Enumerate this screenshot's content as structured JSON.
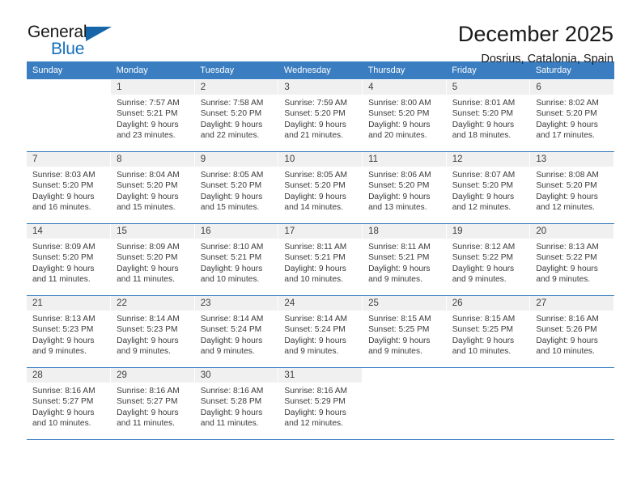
{
  "brand": {
    "name_part1": "General",
    "name_part2": "Blue",
    "triangle_color": "#1565a8",
    "blue_color": "#1570bd"
  },
  "header": {
    "title": "December 2025",
    "subtitle": "Dosrius, Catalonia, Spain"
  },
  "theme": {
    "header_blue": "#3a7dc0",
    "daynum_band": "#f0f0f0",
    "text": "#3a3a3a"
  },
  "columns": [
    "Sunday",
    "Monday",
    "Tuesday",
    "Wednesday",
    "Thursday",
    "Friday",
    "Saturday"
  ],
  "weeks": [
    [
      {
        "day": "",
        "sunrise": "",
        "sunset": "",
        "daylight_line1": "",
        "daylight_line2": ""
      },
      {
        "day": "1",
        "sunrise": "Sunrise: 7:57 AM",
        "sunset": "Sunset: 5:21 PM",
        "daylight_line1": "Daylight: 9 hours",
        "daylight_line2": "and 23 minutes."
      },
      {
        "day": "2",
        "sunrise": "Sunrise: 7:58 AM",
        "sunset": "Sunset: 5:20 PM",
        "daylight_line1": "Daylight: 9 hours",
        "daylight_line2": "and 22 minutes."
      },
      {
        "day": "3",
        "sunrise": "Sunrise: 7:59 AM",
        "sunset": "Sunset: 5:20 PM",
        "daylight_line1": "Daylight: 9 hours",
        "daylight_line2": "and 21 minutes."
      },
      {
        "day": "4",
        "sunrise": "Sunrise: 8:00 AM",
        "sunset": "Sunset: 5:20 PM",
        "daylight_line1": "Daylight: 9 hours",
        "daylight_line2": "and 20 minutes."
      },
      {
        "day": "5",
        "sunrise": "Sunrise: 8:01 AM",
        "sunset": "Sunset: 5:20 PM",
        "daylight_line1": "Daylight: 9 hours",
        "daylight_line2": "and 18 minutes."
      },
      {
        "day": "6",
        "sunrise": "Sunrise: 8:02 AM",
        "sunset": "Sunset: 5:20 PM",
        "daylight_line1": "Daylight: 9 hours",
        "daylight_line2": "and 17 minutes."
      }
    ],
    [
      {
        "day": "7",
        "sunrise": "Sunrise: 8:03 AM",
        "sunset": "Sunset: 5:20 PM",
        "daylight_line1": "Daylight: 9 hours",
        "daylight_line2": "and 16 minutes."
      },
      {
        "day": "8",
        "sunrise": "Sunrise: 8:04 AM",
        "sunset": "Sunset: 5:20 PM",
        "daylight_line1": "Daylight: 9 hours",
        "daylight_line2": "and 15 minutes."
      },
      {
        "day": "9",
        "sunrise": "Sunrise: 8:05 AM",
        "sunset": "Sunset: 5:20 PM",
        "daylight_line1": "Daylight: 9 hours",
        "daylight_line2": "and 15 minutes."
      },
      {
        "day": "10",
        "sunrise": "Sunrise: 8:05 AM",
        "sunset": "Sunset: 5:20 PM",
        "daylight_line1": "Daylight: 9 hours",
        "daylight_line2": "and 14 minutes."
      },
      {
        "day": "11",
        "sunrise": "Sunrise: 8:06 AM",
        "sunset": "Sunset: 5:20 PM",
        "daylight_line1": "Daylight: 9 hours",
        "daylight_line2": "and 13 minutes."
      },
      {
        "day": "12",
        "sunrise": "Sunrise: 8:07 AM",
        "sunset": "Sunset: 5:20 PM",
        "daylight_line1": "Daylight: 9 hours",
        "daylight_line2": "and 12 minutes."
      },
      {
        "day": "13",
        "sunrise": "Sunrise: 8:08 AM",
        "sunset": "Sunset: 5:20 PM",
        "daylight_line1": "Daylight: 9 hours",
        "daylight_line2": "and 12 minutes."
      }
    ],
    [
      {
        "day": "14",
        "sunrise": "Sunrise: 8:09 AM",
        "sunset": "Sunset: 5:20 PM",
        "daylight_line1": "Daylight: 9 hours",
        "daylight_line2": "and 11 minutes."
      },
      {
        "day": "15",
        "sunrise": "Sunrise: 8:09 AM",
        "sunset": "Sunset: 5:20 PM",
        "daylight_line1": "Daylight: 9 hours",
        "daylight_line2": "and 11 minutes."
      },
      {
        "day": "16",
        "sunrise": "Sunrise: 8:10 AM",
        "sunset": "Sunset: 5:21 PM",
        "daylight_line1": "Daylight: 9 hours",
        "daylight_line2": "and 10 minutes."
      },
      {
        "day": "17",
        "sunrise": "Sunrise: 8:11 AM",
        "sunset": "Sunset: 5:21 PM",
        "daylight_line1": "Daylight: 9 hours",
        "daylight_line2": "and 10 minutes."
      },
      {
        "day": "18",
        "sunrise": "Sunrise: 8:11 AM",
        "sunset": "Sunset: 5:21 PM",
        "daylight_line1": "Daylight: 9 hours",
        "daylight_line2": "and 9 minutes."
      },
      {
        "day": "19",
        "sunrise": "Sunrise: 8:12 AM",
        "sunset": "Sunset: 5:22 PM",
        "daylight_line1": "Daylight: 9 hours",
        "daylight_line2": "and 9 minutes."
      },
      {
        "day": "20",
        "sunrise": "Sunrise: 8:13 AM",
        "sunset": "Sunset: 5:22 PM",
        "daylight_line1": "Daylight: 9 hours",
        "daylight_line2": "and 9 minutes."
      }
    ],
    [
      {
        "day": "21",
        "sunrise": "Sunrise: 8:13 AM",
        "sunset": "Sunset: 5:23 PM",
        "daylight_line1": "Daylight: 9 hours",
        "daylight_line2": "and 9 minutes."
      },
      {
        "day": "22",
        "sunrise": "Sunrise: 8:14 AM",
        "sunset": "Sunset: 5:23 PM",
        "daylight_line1": "Daylight: 9 hours",
        "daylight_line2": "and 9 minutes."
      },
      {
        "day": "23",
        "sunrise": "Sunrise: 8:14 AM",
        "sunset": "Sunset: 5:24 PM",
        "daylight_line1": "Daylight: 9 hours",
        "daylight_line2": "and 9 minutes."
      },
      {
        "day": "24",
        "sunrise": "Sunrise: 8:14 AM",
        "sunset": "Sunset: 5:24 PM",
        "daylight_line1": "Daylight: 9 hours",
        "daylight_line2": "and 9 minutes."
      },
      {
        "day": "25",
        "sunrise": "Sunrise: 8:15 AM",
        "sunset": "Sunset: 5:25 PM",
        "daylight_line1": "Daylight: 9 hours",
        "daylight_line2": "and 9 minutes."
      },
      {
        "day": "26",
        "sunrise": "Sunrise: 8:15 AM",
        "sunset": "Sunset: 5:25 PM",
        "daylight_line1": "Daylight: 9 hours",
        "daylight_line2": "and 10 minutes."
      },
      {
        "day": "27",
        "sunrise": "Sunrise: 8:16 AM",
        "sunset": "Sunset: 5:26 PM",
        "daylight_line1": "Daylight: 9 hours",
        "daylight_line2": "and 10 minutes."
      }
    ],
    [
      {
        "day": "28",
        "sunrise": "Sunrise: 8:16 AM",
        "sunset": "Sunset: 5:27 PM",
        "daylight_line1": "Daylight: 9 hours",
        "daylight_line2": "and 10 minutes."
      },
      {
        "day": "29",
        "sunrise": "Sunrise: 8:16 AM",
        "sunset": "Sunset: 5:27 PM",
        "daylight_line1": "Daylight: 9 hours",
        "daylight_line2": "and 11 minutes."
      },
      {
        "day": "30",
        "sunrise": "Sunrise: 8:16 AM",
        "sunset": "Sunset: 5:28 PM",
        "daylight_line1": "Daylight: 9 hours",
        "daylight_line2": "and 11 minutes."
      },
      {
        "day": "31",
        "sunrise": "Sunrise: 8:16 AM",
        "sunset": "Sunset: 5:29 PM",
        "daylight_line1": "Daylight: 9 hours",
        "daylight_line2": "and 12 minutes."
      },
      {
        "day": "",
        "sunrise": "",
        "sunset": "",
        "daylight_line1": "",
        "daylight_line2": ""
      },
      {
        "day": "",
        "sunrise": "",
        "sunset": "",
        "daylight_line1": "",
        "daylight_line2": ""
      },
      {
        "day": "",
        "sunrise": "",
        "sunset": "",
        "daylight_line1": "",
        "daylight_line2": ""
      }
    ]
  ]
}
